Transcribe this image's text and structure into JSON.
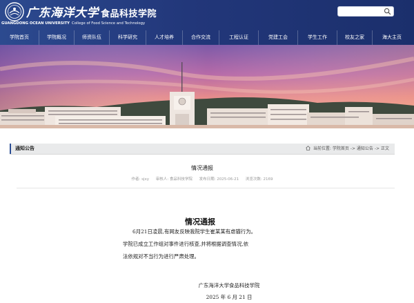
{
  "header": {
    "school_name_cn": "广东海洋大学",
    "college_name_cn": "食品科技学院",
    "school_name_en": "GUANGDONG OCEAN UNIVERSITY",
    "college_name_en": "College of Food Science and Technology",
    "brand_color": "#22377a",
    "search": {
      "placeholder": "",
      "icon": "search-icon"
    }
  },
  "nav": {
    "items": [
      {
        "label": "学院首页"
      },
      {
        "label": "学院概况"
      },
      {
        "label": "师资队伍"
      },
      {
        "label": "科学研究"
      },
      {
        "label": "人才培养"
      },
      {
        "label": "合作交流"
      },
      {
        "label": "工程认证"
      },
      {
        "label": "党建工会"
      },
      {
        "label": "学生工作"
      },
      {
        "label": "校友之家"
      },
      {
        "label": "海大主页"
      }
    ]
  },
  "breadcrumb": {
    "section_title": "通知公告",
    "location_label": "当前位置:",
    "home": "学院首页",
    "sep1": "->",
    "section": "通知公告",
    "sep2": "->",
    "current": "正文"
  },
  "article": {
    "title": "情况通报",
    "meta": {
      "author": "作者: sjxy",
      "reviewer": "审核人: 食品科技学院",
      "date": "发布日期: 2025-06-21",
      "views": "浏览次数: 2169"
    },
    "notice_title": "情况通报",
    "paragraph_lines": [
      "6月21日凌晨,有网友反映我院学生崔某某有虐猫行为。",
      "学院已成立工作组对事件进行核查,并将根据调查情况,依",
      "法依规对不当行为进行严肃处理。"
    ],
    "signature": "广东海洋大学食品科技学院",
    "sign_date": "2025 年 6 月 21 日"
  }
}
